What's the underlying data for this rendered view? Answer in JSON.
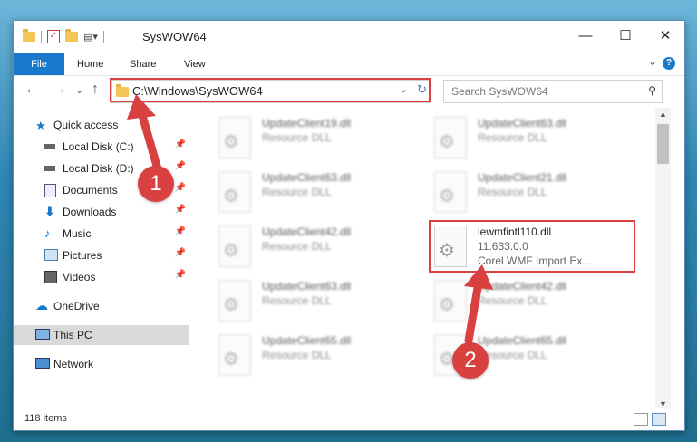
{
  "window": {
    "title": "SysWOW64",
    "controls": {
      "minimize": "—",
      "maximize": "☐",
      "close": "✕"
    }
  },
  "ribbon": {
    "tabs": [
      "File",
      "Home",
      "Share",
      "View"
    ],
    "help": "?",
    "expand": "⌄"
  },
  "nav": {
    "back": "←",
    "forward": "→",
    "recent": "⌄",
    "up": "↑",
    "address": "C:\\Windows\\SysWOW64",
    "search_placeholder": "Search SysWOW64"
  },
  "sidebar": {
    "items": [
      {
        "label": "Quick access",
        "icon": "star-icon"
      },
      {
        "label": "Local Disk (C:)",
        "icon": "drive-icon",
        "pinned": true
      },
      {
        "label": "Local Disk (D:)",
        "icon": "drive-icon",
        "pinned": true
      },
      {
        "label": "Documents",
        "icon": "documents-icon",
        "pinned": true
      },
      {
        "label": "Downloads",
        "icon": "download-icon",
        "pinned": true
      },
      {
        "label": "Music",
        "icon": "music-icon",
        "pinned": true
      },
      {
        "label": "Pictures",
        "icon": "pictures-icon",
        "pinned": true
      },
      {
        "label": "Videos",
        "icon": "videos-icon",
        "pinned": true
      },
      {
        "label": "OneDrive",
        "icon": "cloud-icon"
      },
      {
        "label": "This PC",
        "icon": "computer-icon",
        "selected": true
      },
      {
        "label": "Network",
        "icon": "network-icon"
      }
    ]
  },
  "files": [
    {
      "name": "UpdateClient19.dll",
      "type": "Resource DLL"
    },
    {
      "name": "UpdateClient63.dll",
      "type": "Resource DLL"
    },
    {
      "name": "UpdateClient63.dll",
      "type": "Resource DLL"
    },
    {
      "name": "UpdateClient21.dll",
      "type": "Resource DLL"
    },
    {
      "name": "UpdateClient42.dll",
      "type": "Resource DLL"
    },
    {
      "name": "iewmfintl110.dll",
      "version": "11.633.0.0",
      "description": "Corel WMF Import Ex..."
    },
    {
      "name": "UpdateClient63.dll",
      "type": "Resource DLL"
    },
    {
      "name": "UpdateClient42.dll",
      "type": "Resource DLL"
    },
    {
      "name": "UpdateClient65.dll",
      "type": "Resource DLL"
    },
    {
      "name": "UpdateClient65.dll",
      "type": "Resource DLL"
    }
  ],
  "status": {
    "item_count": "118 items"
  },
  "annotations": {
    "badge1": "1",
    "badge2": "2"
  },
  "colors": {
    "accent": "#1979ca",
    "highlight": "#d94040"
  }
}
